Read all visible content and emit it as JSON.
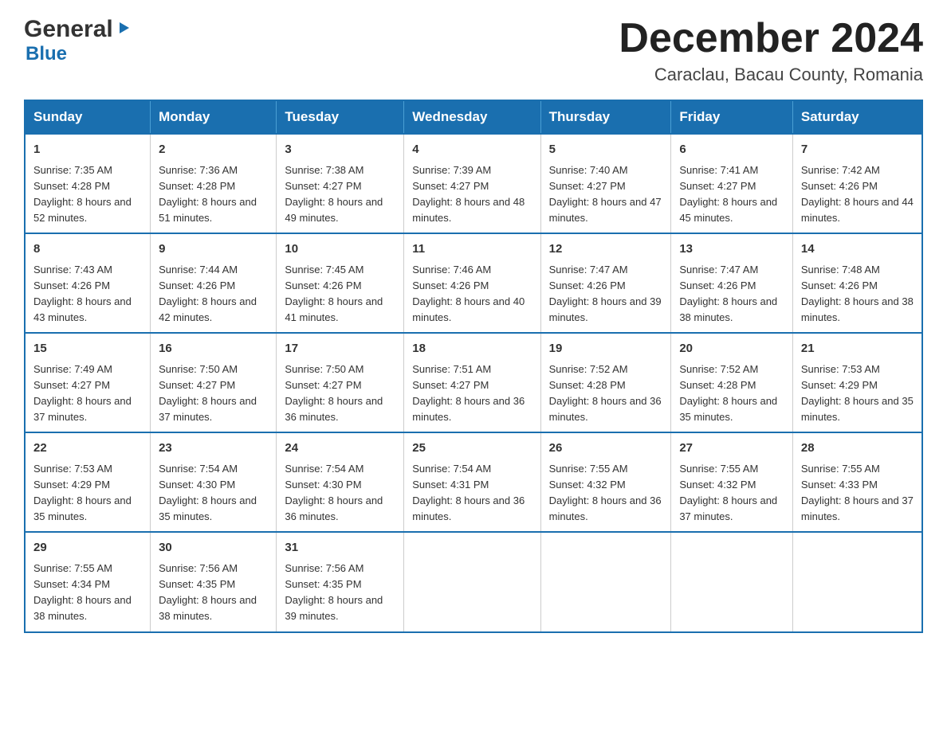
{
  "header": {
    "logo_general": "General",
    "logo_blue": "Blue",
    "title": "December 2024",
    "subtitle": "Caraclau, Bacau County, Romania"
  },
  "calendar": {
    "days_of_week": [
      "Sunday",
      "Monday",
      "Tuesday",
      "Wednesday",
      "Thursday",
      "Friday",
      "Saturday"
    ],
    "weeks": [
      [
        {
          "day": "1",
          "sunrise": "7:35 AM",
          "sunset": "4:28 PM",
          "daylight": "8 hours and 52 minutes."
        },
        {
          "day": "2",
          "sunrise": "7:36 AM",
          "sunset": "4:28 PM",
          "daylight": "8 hours and 51 minutes."
        },
        {
          "day": "3",
          "sunrise": "7:38 AM",
          "sunset": "4:27 PM",
          "daylight": "8 hours and 49 minutes."
        },
        {
          "day": "4",
          "sunrise": "7:39 AM",
          "sunset": "4:27 PM",
          "daylight": "8 hours and 48 minutes."
        },
        {
          "day": "5",
          "sunrise": "7:40 AM",
          "sunset": "4:27 PM",
          "daylight": "8 hours and 47 minutes."
        },
        {
          "day": "6",
          "sunrise": "7:41 AM",
          "sunset": "4:27 PM",
          "daylight": "8 hours and 45 minutes."
        },
        {
          "day": "7",
          "sunrise": "7:42 AM",
          "sunset": "4:26 PM",
          "daylight": "8 hours and 44 minutes."
        }
      ],
      [
        {
          "day": "8",
          "sunrise": "7:43 AM",
          "sunset": "4:26 PM",
          "daylight": "8 hours and 43 minutes."
        },
        {
          "day": "9",
          "sunrise": "7:44 AM",
          "sunset": "4:26 PM",
          "daylight": "8 hours and 42 minutes."
        },
        {
          "day": "10",
          "sunrise": "7:45 AM",
          "sunset": "4:26 PM",
          "daylight": "8 hours and 41 minutes."
        },
        {
          "day": "11",
          "sunrise": "7:46 AM",
          "sunset": "4:26 PM",
          "daylight": "8 hours and 40 minutes."
        },
        {
          "day": "12",
          "sunrise": "7:47 AM",
          "sunset": "4:26 PM",
          "daylight": "8 hours and 39 minutes."
        },
        {
          "day": "13",
          "sunrise": "7:47 AM",
          "sunset": "4:26 PM",
          "daylight": "8 hours and 38 minutes."
        },
        {
          "day": "14",
          "sunrise": "7:48 AM",
          "sunset": "4:26 PM",
          "daylight": "8 hours and 38 minutes."
        }
      ],
      [
        {
          "day": "15",
          "sunrise": "7:49 AM",
          "sunset": "4:27 PM",
          "daylight": "8 hours and 37 minutes."
        },
        {
          "day": "16",
          "sunrise": "7:50 AM",
          "sunset": "4:27 PM",
          "daylight": "8 hours and 37 minutes."
        },
        {
          "day": "17",
          "sunrise": "7:50 AM",
          "sunset": "4:27 PM",
          "daylight": "8 hours and 36 minutes."
        },
        {
          "day": "18",
          "sunrise": "7:51 AM",
          "sunset": "4:27 PM",
          "daylight": "8 hours and 36 minutes."
        },
        {
          "day": "19",
          "sunrise": "7:52 AM",
          "sunset": "4:28 PM",
          "daylight": "8 hours and 36 minutes."
        },
        {
          "day": "20",
          "sunrise": "7:52 AM",
          "sunset": "4:28 PM",
          "daylight": "8 hours and 35 minutes."
        },
        {
          "day": "21",
          "sunrise": "7:53 AM",
          "sunset": "4:29 PM",
          "daylight": "8 hours and 35 minutes."
        }
      ],
      [
        {
          "day": "22",
          "sunrise": "7:53 AM",
          "sunset": "4:29 PM",
          "daylight": "8 hours and 35 minutes."
        },
        {
          "day": "23",
          "sunrise": "7:54 AM",
          "sunset": "4:30 PM",
          "daylight": "8 hours and 35 minutes."
        },
        {
          "day": "24",
          "sunrise": "7:54 AM",
          "sunset": "4:30 PM",
          "daylight": "8 hours and 36 minutes."
        },
        {
          "day": "25",
          "sunrise": "7:54 AM",
          "sunset": "4:31 PM",
          "daylight": "8 hours and 36 minutes."
        },
        {
          "day": "26",
          "sunrise": "7:55 AM",
          "sunset": "4:32 PM",
          "daylight": "8 hours and 36 minutes."
        },
        {
          "day": "27",
          "sunrise": "7:55 AM",
          "sunset": "4:32 PM",
          "daylight": "8 hours and 37 minutes."
        },
        {
          "day": "28",
          "sunrise": "7:55 AM",
          "sunset": "4:33 PM",
          "daylight": "8 hours and 37 minutes."
        }
      ],
      [
        {
          "day": "29",
          "sunrise": "7:55 AM",
          "sunset": "4:34 PM",
          "daylight": "8 hours and 38 minutes."
        },
        {
          "day": "30",
          "sunrise": "7:56 AM",
          "sunset": "4:35 PM",
          "daylight": "8 hours and 38 minutes."
        },
        {
          "day": "31",
          "sunrise": "7:56 AM",
          "sunset": "4:35 PM",
          "daylight": "8 hours and 39 minutes."
        },
        {
          "day": "",
          "sunrise": "",
          "sunset": "",
          "daylight": ""
        },
        {
          "day": "",
          "sunrise": "",
          "sunset": "",
          "daylight": ""
        },
        {
          "day": "",
          "sunrise": "",
          "sunset": "",
          "daylight": ""
        },
        {
          "day": "",
          "sunrise": "",
          "sunset": "",
          "daylight": ""
        }
      ]
    ]
  }
}
